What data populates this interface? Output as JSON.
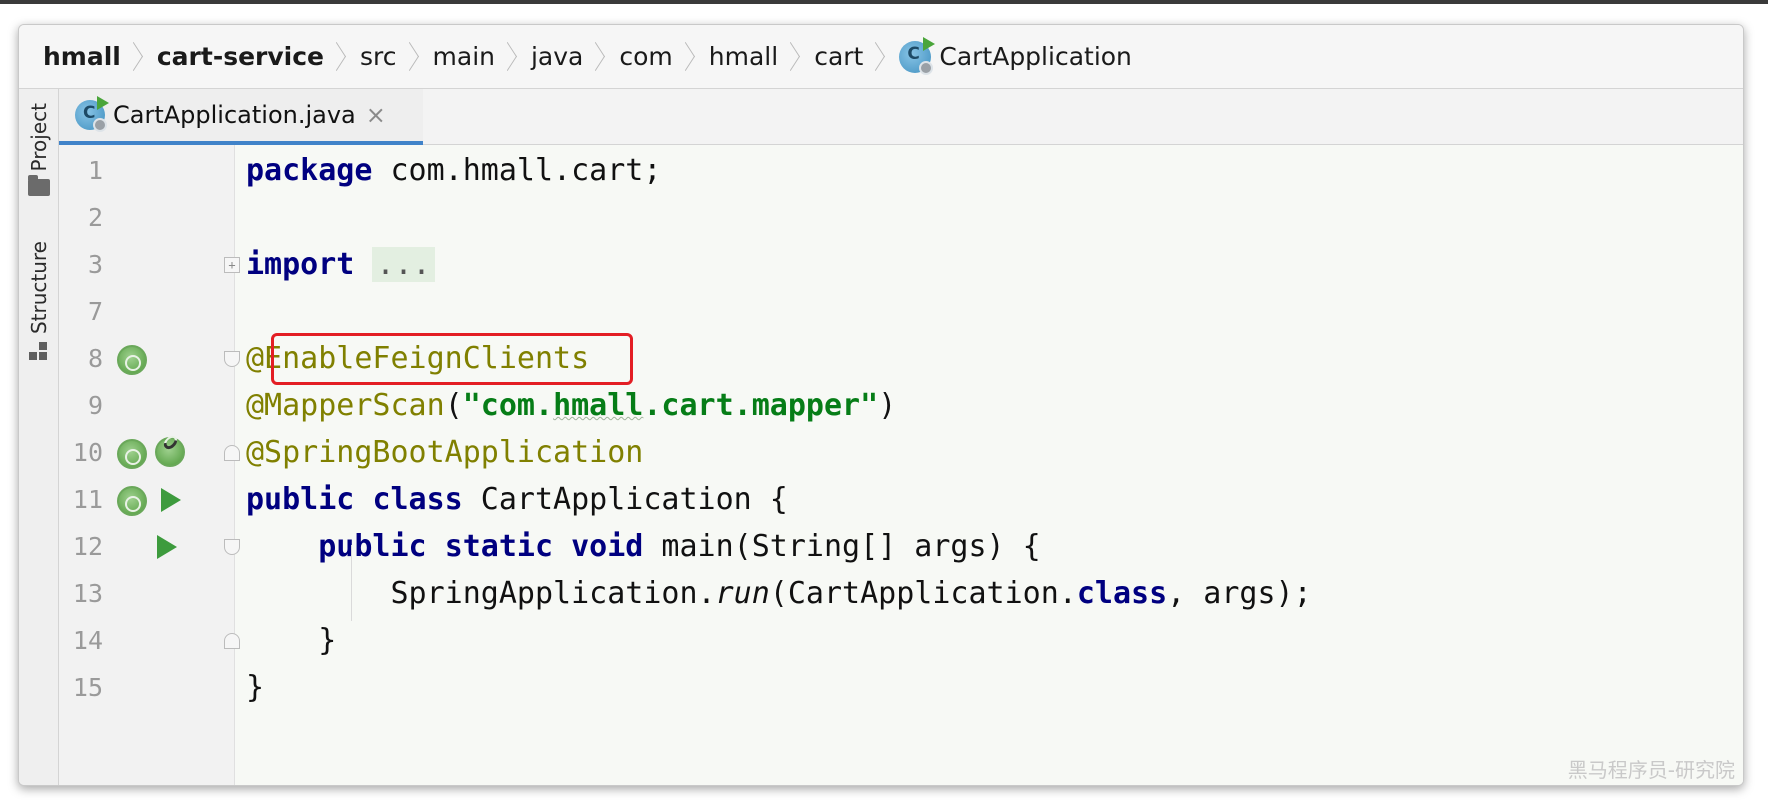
{
  "breadcrumb": {
    "items": [
      "hmall",
      "cart-service",
      "src",
      "main",
      "java",
      "com",
      "hmall",
      "cart",
      "CartApplication"
    ]
  },
  "side_tools": {
    "project_label": "Project",
    "structure_label": "Structure"
  },
  "editor": {
    "tab_title": "CartApplication.java",
    "tab_close": "×",
    "lines": [
      {
        "num": "1"
      },
      {
        "num": "2"
      },
      {
        "num": "3"
      },
      {
        "num": "7"
      },
      {
        "num": "8"
      },
      {
        "num": "9"
      },
      {
        "num": "10"
      },
      {
        "num": "11"
      },
      {
        "num": "12"
      },
      {
        "num": "13"
      },
      {
        "num": "14"
      },
      {
        "num": "15"
      }
    ],
    "tokens": {
      "l1_kw": "package",
      "l1_rest": " com.hmall.cart;",
      "l3_kw": "import",
      "l3_fold": "...",
      "l8_ann": "@EnableFeignClients",
      "l9_ann": "@MapperScan",
      "l9_open": "(",
      "l9_str_a": "\"com.",
      "l9_str_b": "hmall",
      "l9_str_c": ".cart.mapper\"",
      "l9_close": ")",
      "l10_ann": "@SpringBootApplication",
      "l11_kw1": "public",
      "l11_kw2": "class",
      "l11_rest": " CartApplication {",
      "l12_indent": "    ",
      "l12_kw1": "public",
      "l12_kw2": "static",
      "l12_kw3": "void",
      "l12_rest": " main(String[] args) {",
      "l13_a": "        SpringApplication.",
      "l13_run": "run",
      "l13_b": "(CartApplication.",
      "l13_kw": "class",
      "l13_c": ", args);",
      "l14": "    }",
      "l15": "}"
    },
    "highlight_color": "#e31e24"
  },
  "colors": {
    "keyword": "#000080",
    "annotation": "#808000",
    "string": "#067d17",
    "tab_underline": "#4083c9"
  },
  "watermark": "黑马程序员-研究院"
}
